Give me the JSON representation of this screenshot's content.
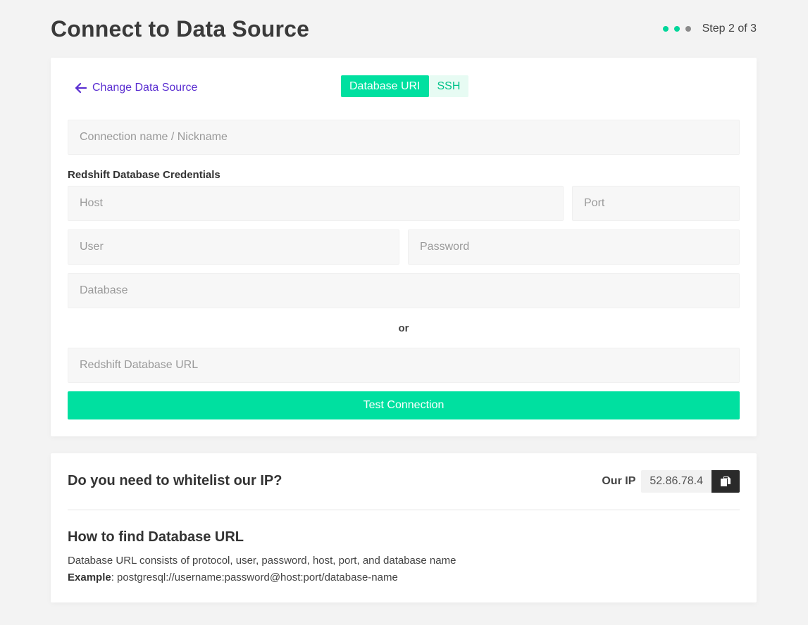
{
  "colors": {
    "accent": "#00e0a0",
    "link": "#5b2fd1",
    "dot_active": "#00d69a",
    "dot_inactive": "#8a8a8a",
    "tab_inactive_text": "#00c28a"
  },
  "header": {
    "title": "Connect to Data Source",
    "step_text": "Step 2 of 3"
  },
  "form": {
    "back_link": "Change Data Source",
    "tabs": [
      {
        "label": "Database URI",
        "active": true
      },
      {
        "label": "SSH",
        "active": false
      }
    ],
    "connection_name": {
      "value": "",
      "placeholder": "Connection name / Nickname"
    },
    "credentials_label": "Redshift Database Credentials",
    "host": {
      "value": "",
      "placeholder": "Host"
    },
    "port": {
      "value": "",
      "placeholder": "Port"
    },
    "user": {
      "value": "",
      "placeholder": "User"
    },
    "password": {
      "value": "",
      "placeholder": "Password"
    },
    "database": {
      "value": "",
      "placeholder": "Database"
    },
    "or_text": "or",
    "url": {
      "value": "",
      "placeholder": "Redshift Database URL"
    },
    "test_button": "Test Connection"
  },
  "whitelist": {
    "heading": "Do you need to whitelist our IP?",
    "ip_label": "Our IP",
    "ip_value": "52.86.78.4",
    "copy_icon": "copy-icon"
  },
  "howto": {
    "title": "How to find Database URL",
    "description": "Database URL consists of protocol, user, password, host, port, and database name",
    "example_label": "Example",
    "example_value": ": postgresql://username:password@host:port/database-name"
  }
}
